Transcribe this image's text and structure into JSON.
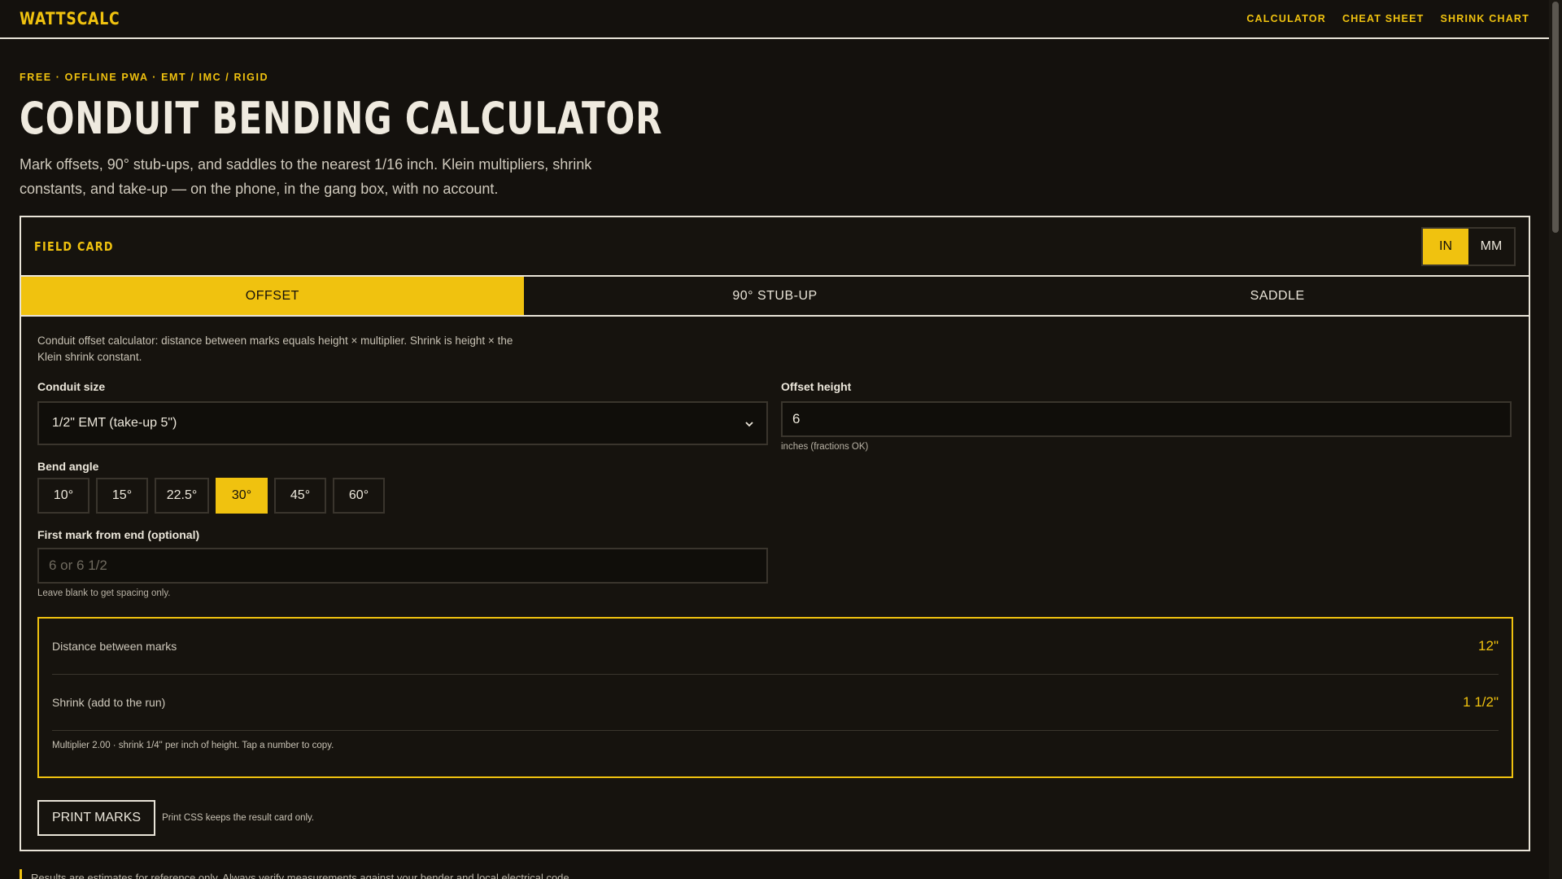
{
  "brand": {
    "logo": "WATTSCALC"
  },
  "nav": {
    "items": [
      "CALCULATOR",
      "CHEAT SHEET",
      "SHRINK CHART"
    ]
  },
  "hero": {
    "eyebrow": "FREE · OFFLINE PWA · EMT / IMC / RIGID",
    "title": "CONDUIT BENDING CALCULATOR",
    "lede": "Mark offsets, 90° stub-ups, and saddles to the nearest 1/16 inch. Klein multipliers, shrink constants, and take-up — on the phone, in the gang box, with no account."
  },
  "card": {
    "title": "FIELD CARD",
    "units": {
      "in": "IN",
      "mm": "MM",
      "selected": "IN"
    },
    "tabs": [
      "OFFSET",
      "90° STUB-UP",
      "SADDLE"
    ],
    "active_tab": "OFFSET",
    "help": "Conduit offset calculator: distance between marks equals height × multiplier. Shrink is height × the Klein shrink constant.",
    "conduit_size": {
      "label": "Conduit size",
      "value": "1/2\" EMT (take-up 5\")"
    },
    "offset_height": {
      "label": "Offset height",
      "value": "6",
      "hint": "inches (fractions OK)"
    },
    "bend_angle": {
      "label": "Bend angle",
      "options": [
        "10°",
        "15°",
        "22.5°",
        "30°",
        "45°",
        "60°"
      ],
      "selected": "30°"
    },
    "first_mark": {
      "label": "First mark from end (optional)",
      "placeholder": "6 or 6 1/2",
      "hint": "Leave blank to get spacing only."
    },
    "results": {
      "distance_label": "Distance between marks",
      "distance_value": "12\"",
      "shrink_label": "Shrink (add to the run)",
      "shrink_value": "1 1/2\"",
      "note": "Multiplier 2.00 · shrink 1/4\" per inch of height. Tap a number to copy."
    },
    "print": {
      "label": "PRINT MARKS",
      "note": "Print CSS keeps the result card only."
    }
  },
  "disclaimer": "Results are estimates for reference only. Always verify measurements against your bender and local electrical code.",
  "colors": {
    "accent": "#f0c20f",
    "background": "#14110d",
    "text": "#e9e4d8"
  }
}
